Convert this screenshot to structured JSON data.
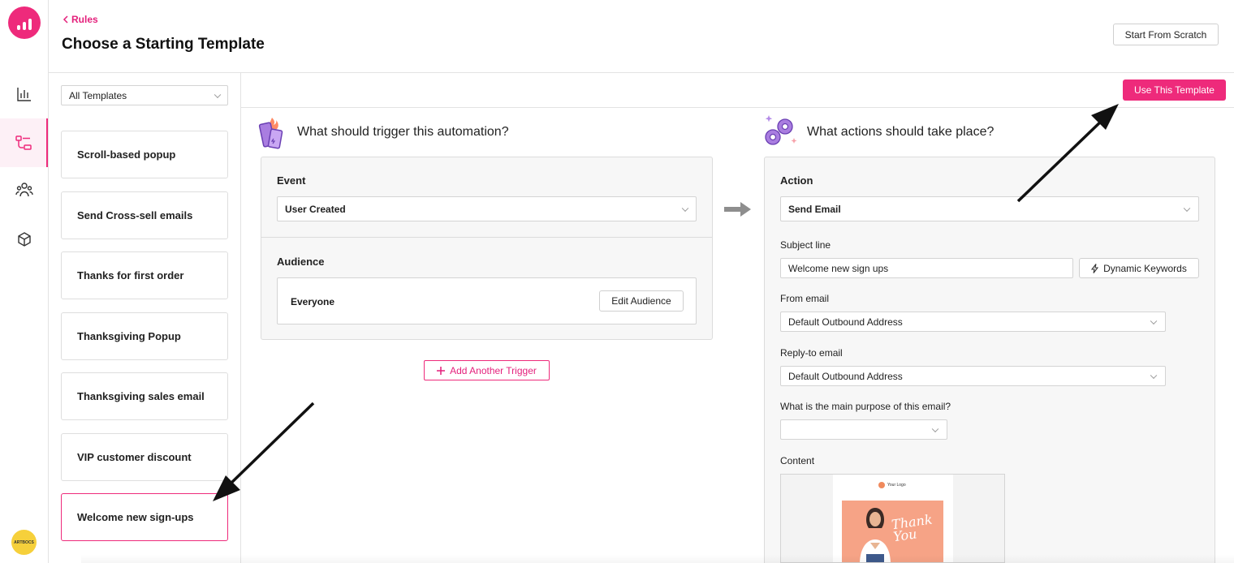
{
  "header": {
    "back_label": "Rules",
    "title": "Choose a Starting Template",
    "start_from_scratch_label": "Start From Scratch"
  },
  "sidebar": {
    "nav": [
      "analytics-icon",
      "automation-rules-icon",
      "audience-icon",
      "box-icon"
    ],
    "active_index": 1,
    "avatar_text": "ARTBOCS"
  },
  "templates": {
    "filter_value": "All Templates",
    "items": [
      "Scroll-based popup",
      "Send Cross-sell emails",
      "Thanks for first order",
      "Thanksgiving Popup",
      "Thanksgiving sales email",
      "VIP customer discount",
      "Welcome new sign-ups"
    ],
    "selected_index": 6
  },
  "use_template_label": "Use This Template",
  "trigger": {
    "title": "What should trigger this automation?",
    "event_label": "Event",
    "event_value": "User Created",
    "audience_label": "Audience",
    "audience_value": "Everyone",
    "edit_audience_label": "Edit Audience",
    "add_trigger_label": "Add Another Trigger"
  },
  "actions": {
    "title": "What actions should take place?",
    "action_label": "Action",
    "action_value": "Send Email",
    "subject_label": "Subject line",
    "subject_value": "Welcome new sign ups",
    "dynamic_keywords_label": "Dynamic Keywords",
    "from_label": "From email",
    "from_value": "Default Outbound Address",
    "reply_label": "Reply-to email",
    "reply_value": "Default Outbound Address",
    "purpose_label": "What is the main purpose of this email?",
    "purpose_value": "",
    "content_label": "Content",
    "preview_logo_text": "Your Logo",
    "preview_headline": "Thank You"
  },
  "colors": {
    "accent": "#ee2a7b",
    "avatar": "#f6d03b",
    "preview_image": "#f6a386"
  }
}
